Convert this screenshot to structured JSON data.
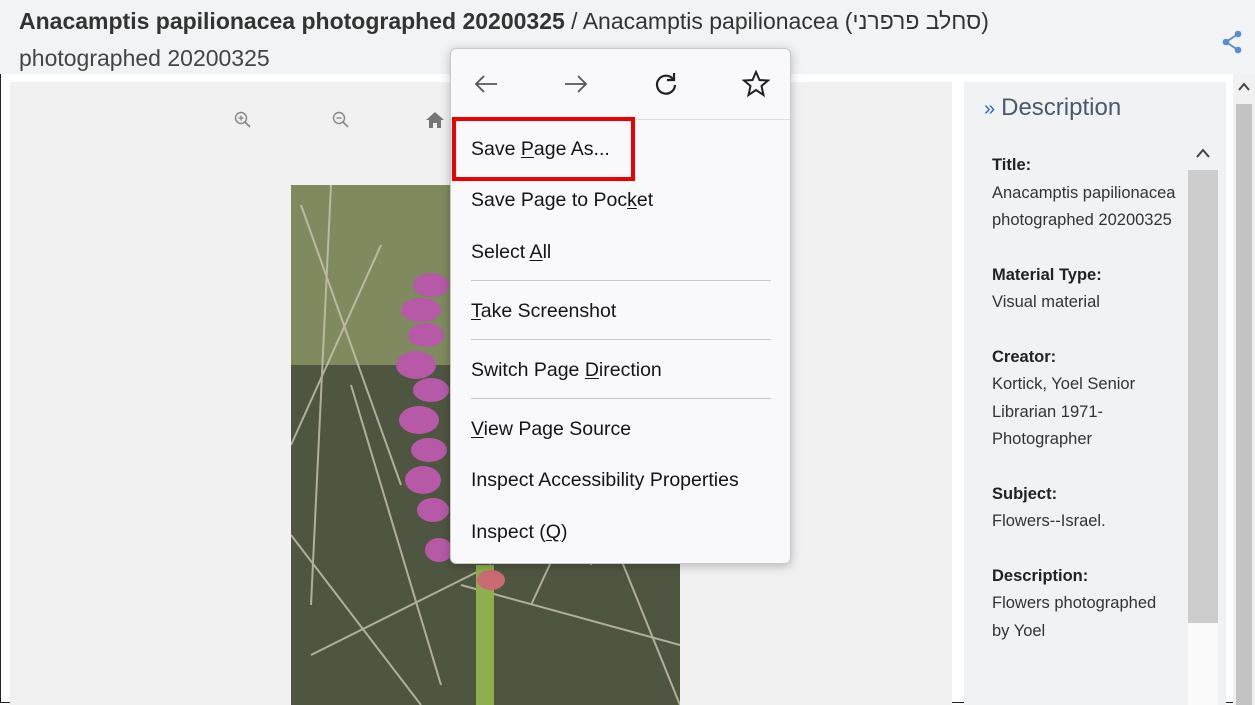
{
  "header": {
    "title_bold": "Anacamptis papilionacea photographed 20200325",
    "title_sep": " / ",
    "title_normal": "Anacamptis papilionacea (סחלב פרפרני)",
    "title_line2": "photographed 20200325"
  },
  "description": {
    "heading": "Description",
    "fields": [
      {
        "label": "Title:",
        "value": "Anacamptis papilionacea photographed 20200325"
      },
      {
        "label": "Material Type:",
        "value": "Visual material"
      },
      {
        "label": "Creator:",
        "value": "Kortick, Yoel Senior Librarian 1971- Photographer"
      },
      {
        "label": "Subject:",
        "value": "Flowers--Israel."
      },
      {
        "label": "Description:",
        "value": "Flowers photographed by Yoel"
      }
    ]
  },
  "context_menu": {
    "items": [
      {
        "pre": "Save ",
        "key": "P",
        "post": "age As..."
      },
      {
        "pre": "Save Page to Poc",
        "key": "k",
        "post": "et"
      },
      {
        "pre": "Select ",
        "key": "A",
        "post": "ll"
      },
      {
        "pre": "",
        "key": "T",
        "post": "ake Screenshot"
      },
      {
        "pre": "Switch Page ",
        "key": "D",
        "post": "irection"
      },
      {
        "pre": "",
        "key": "V",
        "post": "iew Page Source"
      },
      {
        "pre": "Inspect Accessibility Properties",
        "key": "",
        "post": ""
      },
      {
        "pre": "Inspect (",
        "key": "Q",
        "post": ")"
      }
    ]
  },
  "colors": {
    "highlight": "#ee0000",
    "accent": "#2a6ac9"
  }
}
